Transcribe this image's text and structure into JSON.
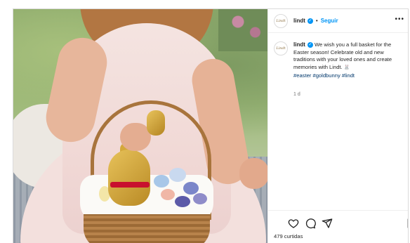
{
  "post": {
    "username": "lindt",
    "follow_label": "Seguir",
    "avatar_text": "Lindt",
    "caption": {
      "username": "lindt",
      "text": "We wish you a full basket for the Easter season! Celebrate old and new traditions with your loved ones and create memories with Lindt.",
      "emoji": "🐰",
      "hashtags": [
        "#easter",
        "#goldbunny",
        "#lindt"
      ]
    },
    "age": "1 d",
    "likes": "479 curtidas"
  },
  "icons": {
    "verified": "verified-badge-icon",
    "more": "more-options-icon",
    "like": "heart-icon",
    "comment": "comment-icon",
    "share": "paper-plane-icon",
    "save": "bookmark-icon"
  },
  "colors": {
    "link_blue": "#0095f6",
    "hashtag": "#00376b",
    "text": "#262626",
    "muted": "#737373",
    "border": "#dbdbdb"
  }
}
